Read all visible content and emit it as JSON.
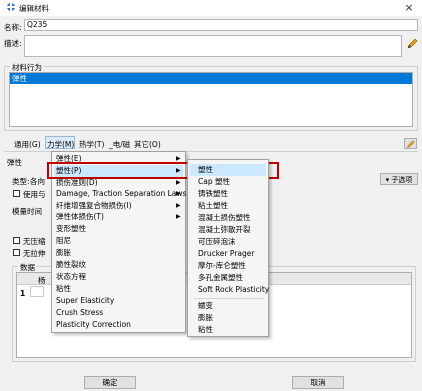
{
  "window": {
    "title": "编辑材料",
    "close": "×"
  },
  "name": {
    "label": "名称:",
    "value": "Q235"
  },
  "desc": {
    "label": "描述:",
    "value": ""
  },
  "behavior": {
    "group_title": "材料行为",
    "items": [
      "弹性"
    ]
  },
  "menubar": [
    {
      "label": "通用(G)",
      "underline": "G"
    },
    {
      "label": "力学(M)",
      "underline": "M"
    },
    {
      "label": "热学(T)",
      "underline": "T"
    },
    {
      "label": "_电/磁",
      "underline": ""
    },
    {
      "label": "其它(O)",
      "underline": "O"
    }
  ],
  "panel": {
    "elastic_title": "弹性",
    "type_label": "类型:",
    "type_value": "各向",
    "use_label": "使用与",
    "moduli_label": "模量时间",
    "no_comp_label": "无压缩",
    "no_tension_label": "无拉伸",
    "data_label": "数据",
    "row_label": "1",
    "col_header": "杨",
    "suboptions": "子选项"
  },
  "mech_menu": [
    {
      "label": "弹性(E)",
      "arrow": true
    },
    {
      "label": "塑性(P)",
      "arrow": true,
      "highlight": true
    },
    {
      "label": "损伤准则(D)",
      "arrow": true
    },
    {
      "label": "Damage, Traction Separation Laws(G)",
      "arrow": true
    },
    {
      "label": "纤维增强复合物损伤(I)",
      "arrow": true
    },
    {
      "label": "弹性体损伤(T)",
      "arrow": true
    },
    {
      "label": "变形塑性",
      "arrow": false
    },
    {
      "label": "阻尼",
      "arrow": false
    },
    {
      "label": "膨胀",
      "arrow": false
    },
    {
      "label": "脆性裂纹",
      "arrow": false
    },
    {
      "label": "状态方程",
      "arrow": false
    },
    {
      "label": "粘性",
      "arrow": false
    },
    {
      "label": "Super Elasticity",
      "arrow": false
    },
    {
      "label": "Crush Stress",
      "arrow": false
    },
    {
      "label": "Plasticity Correction",
      "arrow": false
    }
  ],
  "plastic_menu": [
    {
      "label": "塑性",
      "highlight": true
    },
    {
      "label": "Cap 塑性"
    },
    {
      "label": "铸铁塑性"
    },
    {
      "label": "粘土塑性"
    },
    {
      "label": "混凝土损伤塑性"
    },
    {
      "label": "混凝土弥散开裂"
    },
    {
      "label": "可压碎泡沫"
    },
    {
      "label": "Drucker Prager"
    },
    {
      "label": "摩尔-库仑塑性"
    },
    {
      "label": "多孔金属塑性"
    },
    {
      "label": "Soft Rock Plasticity"
    },
    {
      "sep": true
    },
    {
      "label": "蠕变"
    },
    {
      "label": "膨胀"
    },
    {
      "label": "粘性"
    }
  ],
  "buttons": {
    "ok": "确定",
    "cancel": "取消"
  },
  "colors": {
    "selected": "#0078d7",
    "highlight_box": "#c00000",
    "menu_hover": "#cce8ff"
  },
  "icons": {
    "title": "material-edit-icon",
    "pencil": "pencil-icon",
    "close": "close-icon"
  }
}
